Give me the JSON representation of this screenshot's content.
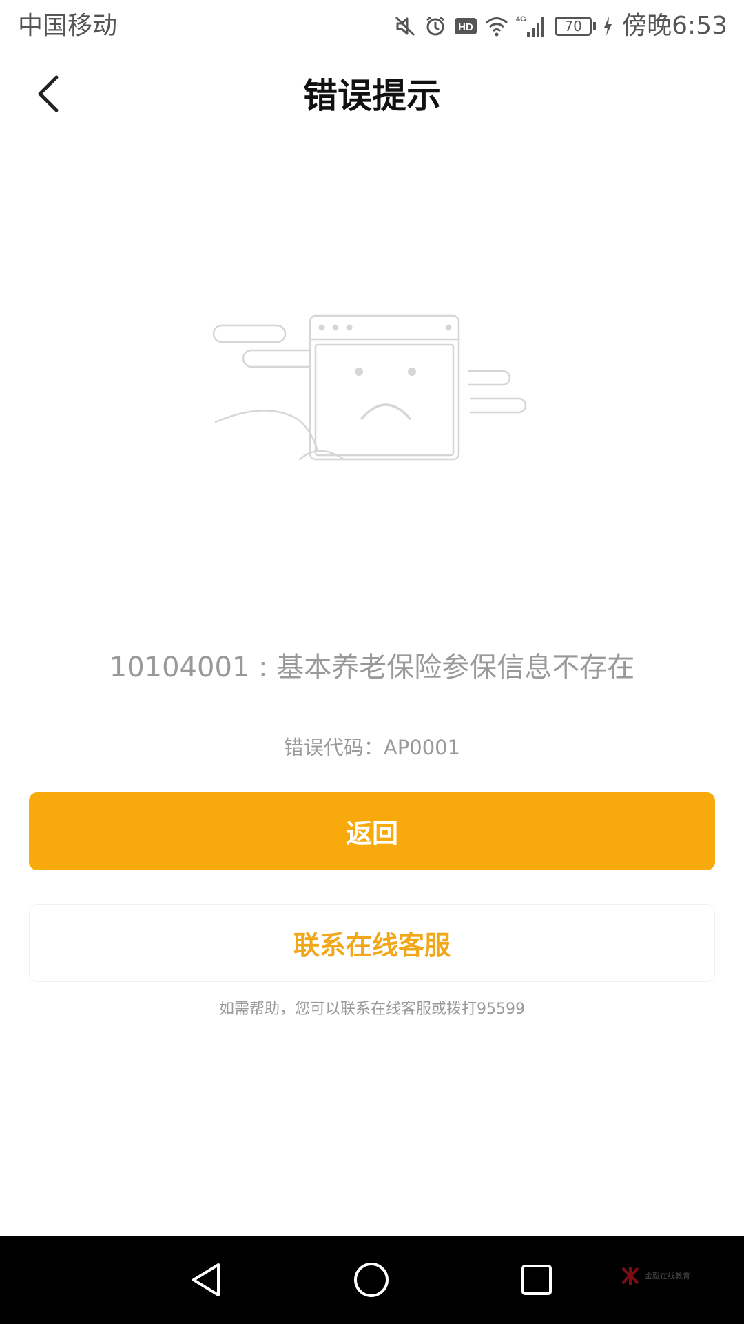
{
  "status_bar": {
    "carrier": "中国移动",
    "network": "4G",
    "battery": "70",
    "time": "傍晚6:53"
  },
  "header": {
    "title": "错误提示"
  },
  "error": {
    "message": "10104001 : 基本养老保险参保信息不存在",
    "code_line": "错误代码：AP0001"
  },
  "actions": {
    "back_label": "返回",
    "contact_label": "联系在线客服"
  },
  "help": {
    "text": "如需帮助，您可以联系在线客服或拨打95599"
  },
  "colors": {
    "primary": "#f8aa0c",
    "secondary_text": "#f0a81a",
    "muted_text": "#999999"
  },
  "watermark": {
    "text": "金融在线教育"
  }
}
